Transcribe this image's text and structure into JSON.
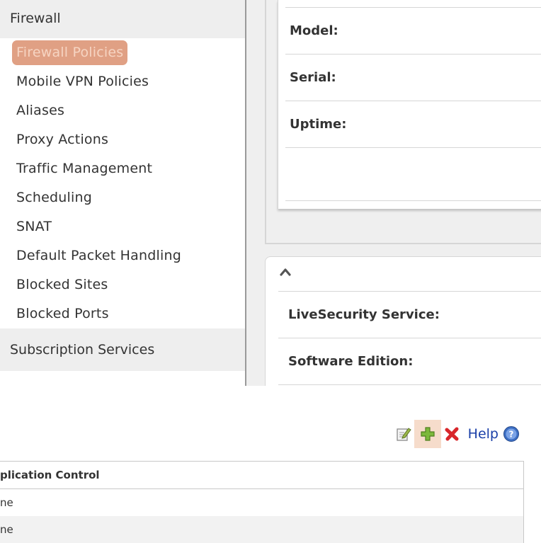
{
  "sidebar": {
    "section_title": "Firewall",
    "items": [
      {
        "label": "Firewall Policies",
        "active": true
      },
      {
        "label": "Mobile VPN Policies"
      },
      {
        "label": "Aliases"
      },
      {
        "label": "Proxy Actions"
      },
      {
        "label": "Traffic Management"
      },
      {
        "label": "Scheduling"
      },
      {
        "label": "SNAT"
      },
      {
        "label": "Default Packet Handling"
      },
      {
        "label": "Blocked Sites"
      },
      {
        "label": "Blocked Ports"
      }
    ],
    "next_section_title": "Subscription Services"
  },
  "device_info": {
    "model_label": "Model:",
    "serial_label": "Serial:",
    "uptime_label": "Uptime:"
  },
  "services_panel": {
    "collapse_icon": "chevron-up-icon",
    "livesecurity_label": "LiveSecurity Service:",
    "software_edition_label": "Software Edition:"
  },
  "toolbar": {
    "edit_icon": "edit-icon",
    "add_icon": "add-icon",
    "delete_icon": "delete-icon",
    "help_label": "Help",
    "help_icon": "help-icon",
    "add_highlight_color": "#f6dccb"
  },
  "policy_table": {
    "column_header": "plication Control",
    "rows": [
      "ne",
      "ne"
    ]
  },
  "colors": {
    "active_item_bg": "#e0a084",
    "help_link": "#1a3fa8"
  }
}
